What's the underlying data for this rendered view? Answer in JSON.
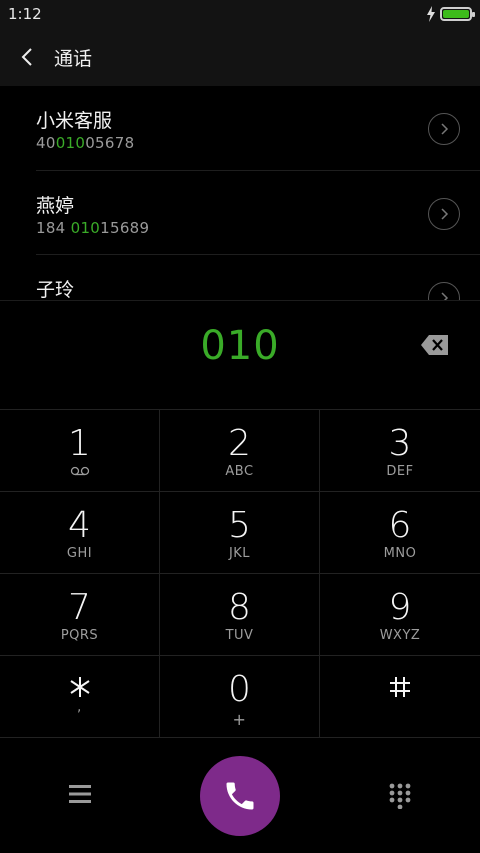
{
  "status_bar": {
    "time": "1:12",
    "battery_level": 1.0
  },
  "header": {
    "title": "通话"
  },
  "contacts": [
    {
      "name": "小米客服",
      "number_before": "40",
      "number_match": "010",
      "number_after": "05678"
    },
    {
      "name": "燕婷",
      "number_before": "184 ",
      "number_match": "010",
      "number_after": "15689"
    },
    {
      "name": "子玲",
      "number_before": "",
      "number_match": "",
      "number_after": ""
    }
  ],
  "dialer": {
    "input": "010"
  },
  "keypad": [
    {
      "digit": "1",
      "sub": ""
    },
    {
      "digit": "2",
      "sub": "ABC"
    },
    {
      "digit": "3",
      "sub": "DEF"
    },
    {
      "digit": "4",
      "sub": "GHI"
    },
    {
      "digit": "5",
      "sub": "JKL"
    },
    {
      "digit": "6",
      "sub": "MNO"
    },
    {
      "digit": "7",
      "sub": "PQRS"
    },
    {
      "digit": "8",
      "sub": "TUV"
    },
    {
      "digit": "9",
      "sub": "WXYZ"
    },
    {
      "digit": "*",
      "sub": ","
    },
    {
      "digit": "0",
      "sub": "+"
    },
    {
      "digit": "#",
      "sub": ""
    }
  ],
  "colors": {
    "accent_green": "#3aab28",
    "call_purple": "#7e2a8a"
  },
  "icons": {
    "status": [
      "charging-bolt-icon",
      "battery-icon"
    ],
    "header": "back-icon",
    "row": "chevron-right-icon",
    "input": "backspace-icon",
    "bottom": [
      "menu-icon",
      "phone-icon",
      "dialpad-icon"
    ],
    "key_1": "voicemail-icon"
  }
}
